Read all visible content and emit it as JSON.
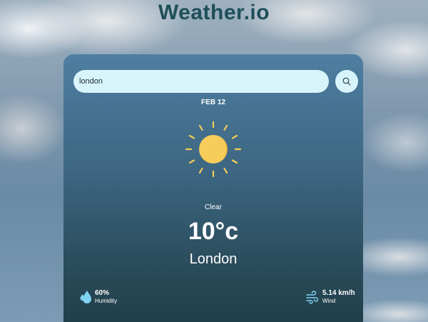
{
  "app": {
    "title": "Weather.io"
  },
  "search": {
    "value": "london",
    "placeholder": ""
  },
  "weather": {
    "date": "FEB 12",
    "condition": "Clear",
    "temperature": "10°c",
    "city": "London",
    "humidity": {
      "value": "60%",
      "label": "Humidity"
    },
    "wind": {
      "value": "5.14 km/h",
      "label": "Wind"
    }
  },
  "icons": {
    "search": "search-icon",
    "weather": "sun-icon",
    "humidity": "water-drops-icon",
    "wind": "wind-icon"
  },
  "colors": {
    "title": "#1f4f5a",
    "input_bg": "#d8f4fb",
    "sun": "#f6cc5a",
    "card_top": "#4f7ea2",
    "card_bottom": "#213f4a"
  }
}
